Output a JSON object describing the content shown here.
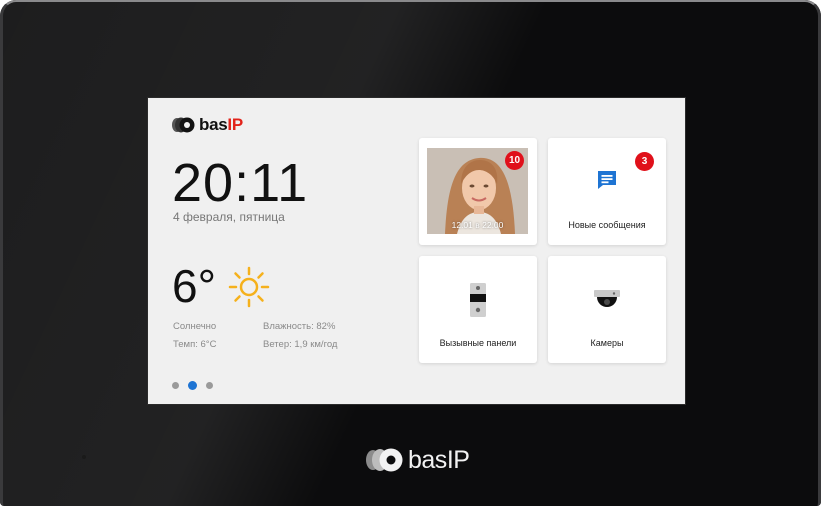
{
  "brand": {
    "name": "bas",
    "suffix": "IP",
    "suffix_color": "#e2231a"
  },
  "home": {
    "time": "20:11",
    "date": "4 февраля, пятница",
    "temperature": "6°",
    "weather_icon": "sun-icon",
    "condition": "Солнечно",
    "humidity": "Влажность: 82%",
    "feels": "Темп: 6°C",
    "wind": "Ветер: 1,9 км/год",
    "page_count": 3,
    "active_page": 2
  },
  "tiles": {
    "visitors": {
      "badge": "10",
      "timestamp": "12.01 в 22:00"
    },
    "messages": {
      "label": "Новые сообщения",
      "badge": "3",
      "icon": "message-icon"
    },
    "panels": {
      "label": "Вызывные панели",
      "icon": "intercom-panel-icon"
    },
    "cameras": {
      "label": "Камеры",
      "icon": "dome-camera-icon"
    }
  },
  "colors": {
    "accent": "#1e74d3",
    "badge": "#e0101a",
    "sun": "#f5b11c"
  }
}
